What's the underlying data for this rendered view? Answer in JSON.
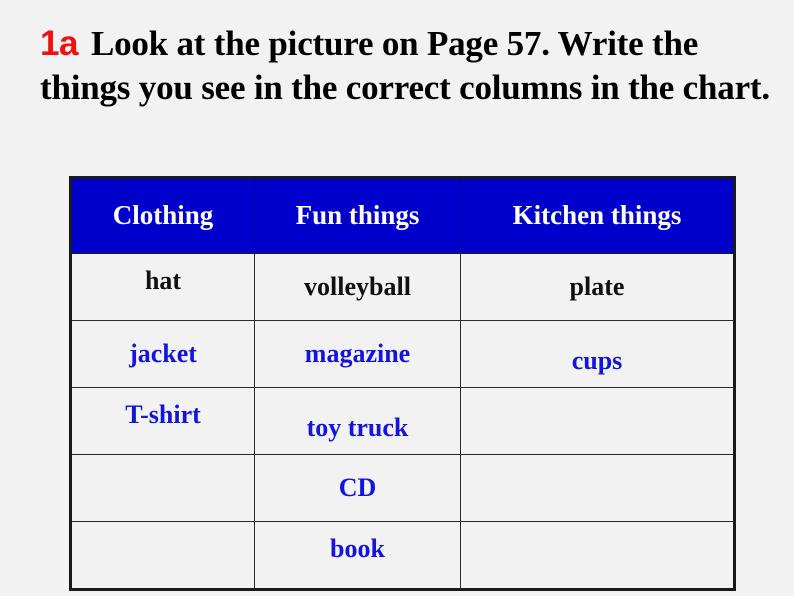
{
  "slide": {
    "background_color": "#f2f2f2"
  },
  "heading": {
    "tag": "1a",
    "tag_color": "#ee1111",
    "text": "Look at the picture on Page 57. Write the things you see in the correct columns in the chart."
  },
  "chart_data": {
    "type": "table",
    "title": "",
    "header_background": "#0000cc",
    "header_text_color": "#ffffff",
    "columns": [
      "Clothing",
      "Fun things",
      "Kitchen things"
    ],
    "rows": [
      [
        "hat",
        "volleyball",
        "plate"
      ],
      [
        "jacket",
        "magazine",
        "cups"
      ],
      [
        "T-shirt",
        "toy truck",
        ""
      ],
      [
        "",
        "CD",
        ""
      ],
      [
        "",
        "book",
        ""
      ]
    ],
    "cell_colors": [
      [
        "#111111",
        "#111111",
        "#111111"
      ],
      [
        "#1414e0",
        "#1414e0",
        "#1414e0"
      ],
      [
        "#1414e0",
        "#1414e0",
        ""
      ],
      [
        "",
        "#1414e0",
        ""
      ],
      [
        "",
        "#1414e0",
        ""
      ]
    ]
  }
}
